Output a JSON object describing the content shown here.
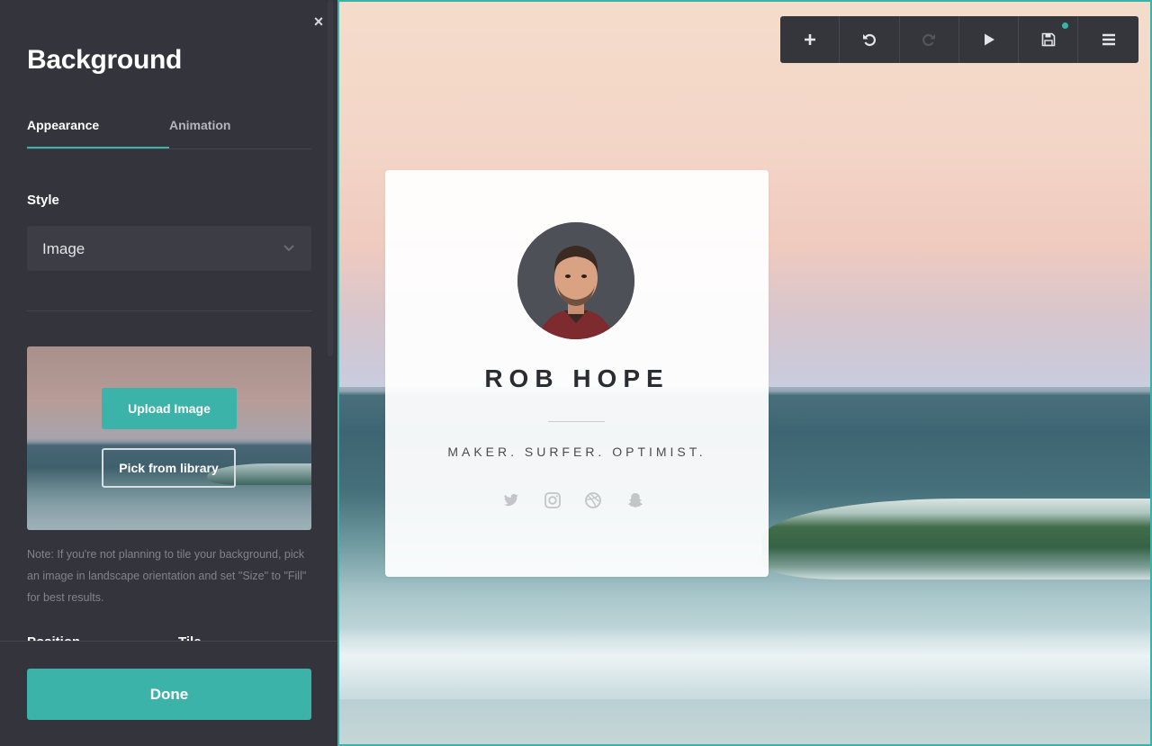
{
  "sidebar": {
    "title": "Background",
    "close_symbol": "×",
    "tabs": [
      {
        "label": "Appearance",
        "active": true
      },
      {
        "label": "Animation",
        "active": false
      }
    ],
    "style": {
      "label": "Style",
      "selected": "Image"
    },
    "image_picker": {
      "upload_label": "Upload Image",
      "library_label": "Pick from library"
    },
    "note": "Note: If you're not planning to tile your background, pick an image in landscape orientation and set \"Size\" to \"Fill\" for best results.",
    "partial_labels": [
      "Position",
      "Tile"
    ],
    "done_label": "Done"
  },
  "toolbar": {
    "buttons": [
      {
        "name": "add",
        "icon": "plus-icon"
      },
      {
        "name": "undo",
        "icon": "undo-icon"
      },
      {
        "name": "redo",
        "icon": "redo-icon",
        "disabled": true
      },
      {
        "name": "preview",
        "icon": "play-icon"
      },
      {
        "name": "save",
        "icon": "save-icon",
        "unsaved_indicator": true
      },
      {
        "name": "menu",
        "icon": "hamburger-menu-icon"
      }
    ]
  },
  "profile": {
    "name": "ROB HOPE",
    "tagline": "MAKER. SURFER. OPTIMIST.",
    "social": [
      "twitter-icon",
      "instagram-icon",
      "dribbble-icon",
      "snapchat-icon"
    ]
  },
  "colors": {
    "accent": "#3bb3a9",
    "sidebar_bg": "#34353c",
    "toolbar_bg": "#35363c"
  }
}
